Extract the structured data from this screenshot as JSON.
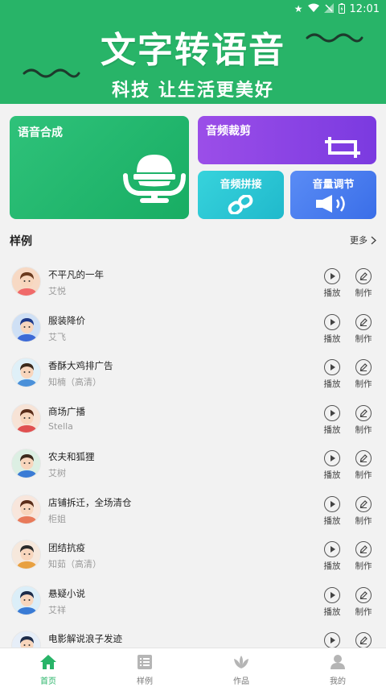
{
  "status_bar": {
    "time": "12:01"
  },
  "header": {
    "title": "文字转语音",
    "subtitle": "科技  让生活更美好",
    "bg_color": "#28b468"
  },
  "features": {
    "tts": {
      "label": "语音合成",
      "icon": "microphone-icon"
    },
    "crop": {
      "label": "音频裁剪",
      "icon": "crop-icon"
    },
    "join": {
      "label": "音频拼接",
      "icon": "link-icon"
    },
    "volume": {
      "label": "音量调节",
      "icon": "speaker-icon"
    }
  },
  "samples": {
    "title": "样例",
    "more_label": "更多",
    "play_label": "播放",
    "make_label": "制作",
    "items": [
      {
        "title": "不平凡的一年",
        "voice": "艾悦"
      },
      {
        "title": "服装降价",
        "voice": "艾飞"
      },
      {
        "title": "香酥大鸡排广告",
        "voice": "知楠（高清）"
      },
      {
        "title": "商场广播",
        "voice": "Stella"
      },
      {
        "title": "农夫和狐狸",
        "voice": "艾树"
      },
      {
        "title": "店铺拆迁，全场清仓",
        "voice": "柜姐"
      },
      {
        "title": "团结抗疫",
        "voice": "知茹（高清）"
      },
      {
        "title": "悬疑小说",
        "voice": "艾祥"
      },
      {
        "title": "电影解说浪子发迹",
        "voice": ""
      }
    ]
  },
  "bottom_nav": {
    "active_color": "#28b468",
    "items": [
      {
        "label": "首页",
        "icon": "home-icon"
      },
      {
        "label": "样例",
        "icon": "list-icon"
      },
      {
        "label": "作品",
        "icon": "works-icon"
      },
      {
        "label": "我的",
        "icon": "user-icon"
      }
    ]
  }
}
